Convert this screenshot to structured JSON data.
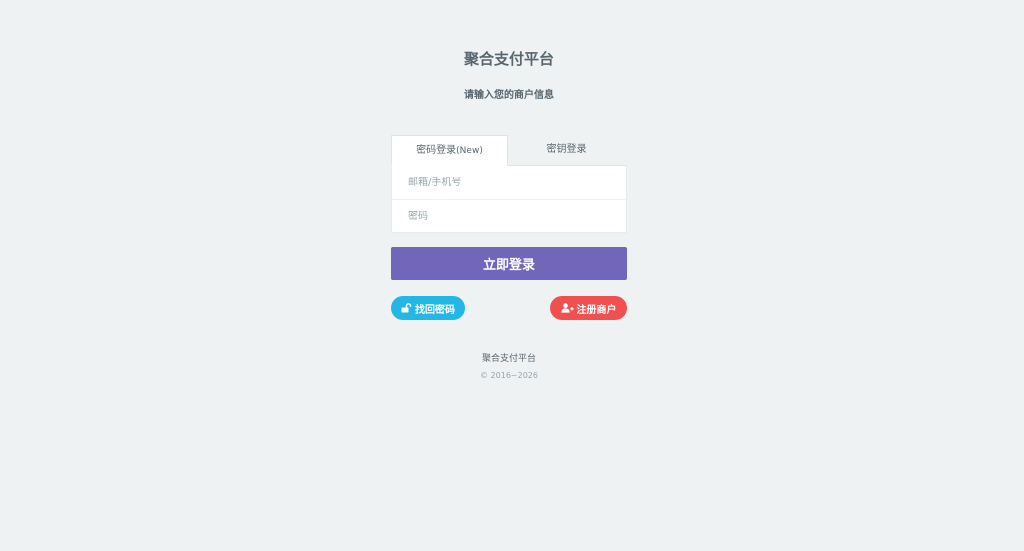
{
  "header": {
    "title": "聚合支付平台",
    "subtitle": "请输入您的商户信息"
  },
  "tabs": [
    {
      "label": "密码登录",
      "suffix": "(New)",
      "active": true
    },
    {
      "label": "密钥登录",
      "active": false
    }
  ],
  "form": {
    "account_placeholder": "邮箱/手机号",
    "password_placeholder": "密码",
    "submit_label": "立即登录"
  },
  "actions": {
    "recover_label": "找回密码",
    "recover_icon": "unlock-icon",
    "recover_color": "#23b7e5",
    "register_label": "注册商户",
    "register_icon": "user-plus-icon",
    "register_color": "#f05050"
  },
  "footer": {
    "name": "聚合支付平台",
    "copyright": "© 2016~2026"
  },
  "colors": {
    "primary": "#7266ba",
    "background": "#eef2f3",
    "text": "#58666e"
  }
}
